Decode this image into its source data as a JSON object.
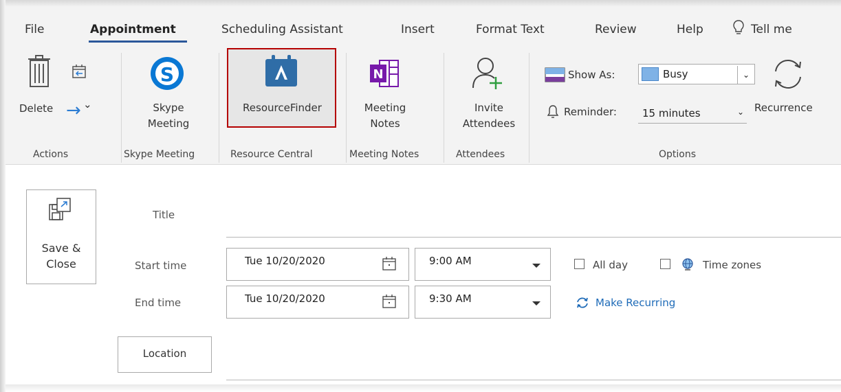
{
  "tabs": [
    "File",
    "Appointment",
    "Scheduling Assistant",
    "Insert",
    "Format Text",
    "Review",
    "Help",
    "Tell me"
  ],
  "actions": {
    "delete_label": "Delete",
    "forward_arrow": "→",
    "forward_chevron": "⌄",
    "group_label": "Actions"
  },
  "skype": {
    "label_line1": "Skype",
    "label_line2": "Meeting",
    "group_label": "Skype Meeting"
  },
  "resource": {
    "label": "ResourceFinder",
    "group_label": "Resource Central"
  },
  "notes": {
    "label_line1": "Meeting",
    "label_line2": "Notes",
    "group_label": "Meeting Notes"
  },
  "attendees": {
    "label_line1": "Invite",
    "label_line2": "Attendees",
    "group_label": "Attendees"
  },
  "options": {
    "show_as_label": "Show As:",
    "show_as_value": "Busy",
    "reminder_label": "Reminder:",
    "reminder_value": "15 minutes",
    "recurrence_label": "Recurrence",
    "group_label": "Options"
  },
  "form": {
    "save_close_line1": "Save &",
    "save_close_line2": "Close",
    "title_label": "Title",
    "start_label": "Start time",
    "end_label": "End time",
    "start_date": "Tue 10/20/2020",
    "start_time": "9:00 AM",
    "end_date": "Tue 10/20/2020",
    "end_time": "9:30 AM",
    "all_day_label": "All day",
    "time_zones_label": "Time zones",
    "make_recurring_label": "Make Recurring",
    "location_label": "Location"
  },
  "colors": {
    "accent": "#2b579a",
    "highlight_border": "#b40000",
    "busy_swatch": "#7fb2e6",
    "link": "#1e6bb8"
  }
}
